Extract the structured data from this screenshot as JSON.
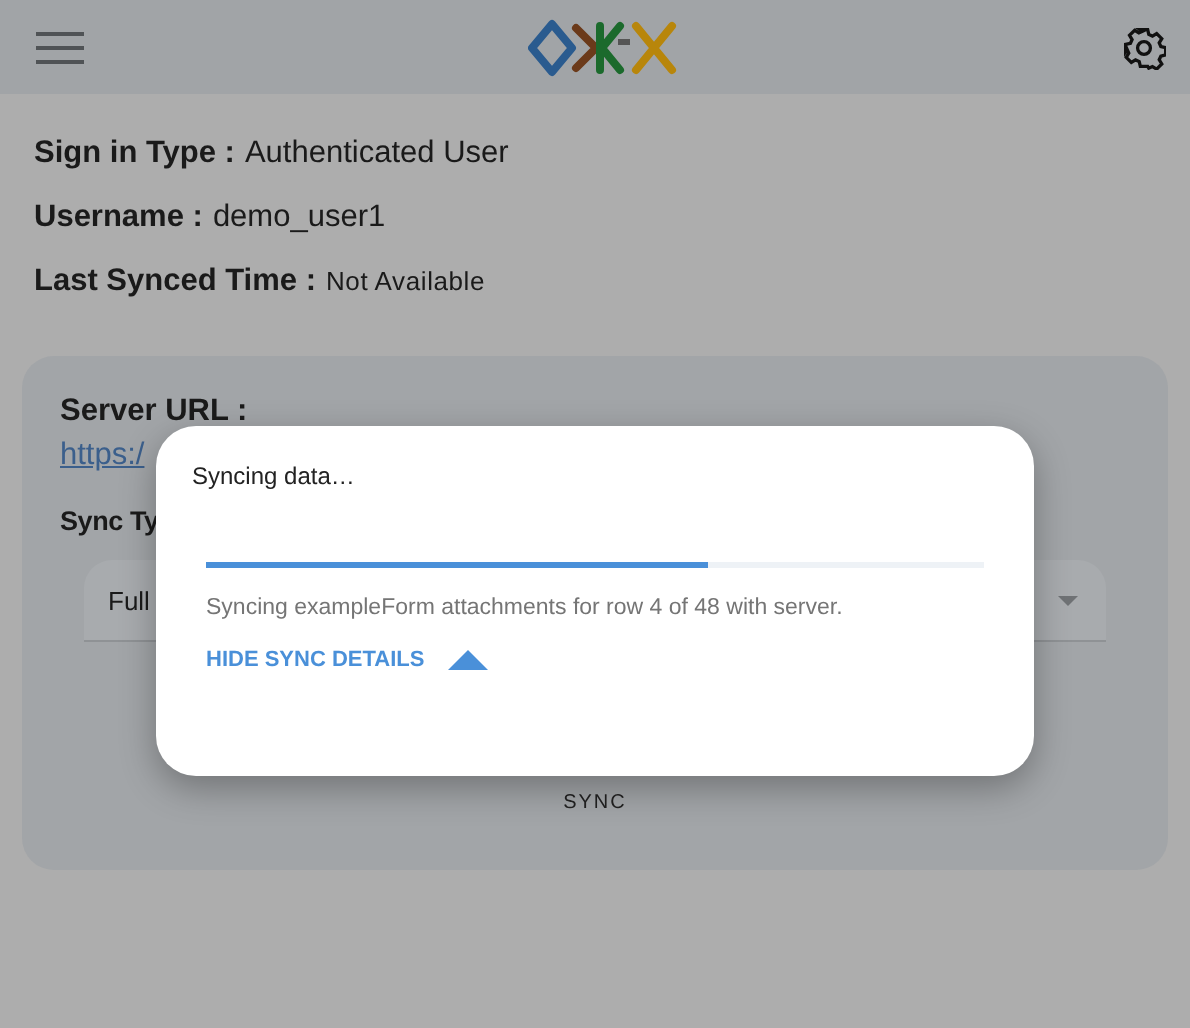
{
  "info": [
    {
      "label": "Sign in Type :",
      "value": "Authenticated User",
      "small": false
    },
    {
      "label": "Username :",
      "value": "demo_user1",
      "small": false
    },
    {
      "label": "Last Synced Time :",
      "value": "Not Available",
      "small": true
    }
  ],
  "card": {
    "server_label": "Server URL :",
    "server_url": "https:/",
    "sync_type_label": "Sync Ty",
    "sync_type_value": "Full",
    "sync_button": "SYNC"
  },
  "dialog": {
    "title": "Syncing data…",
    "level": 0.645,
    "message": "Syncing exampleForm attachments for row 4 of 48 with server.",
    "details_toggle": "HIDE SYNC DETAILS",
    "expanded": true
  }
}
